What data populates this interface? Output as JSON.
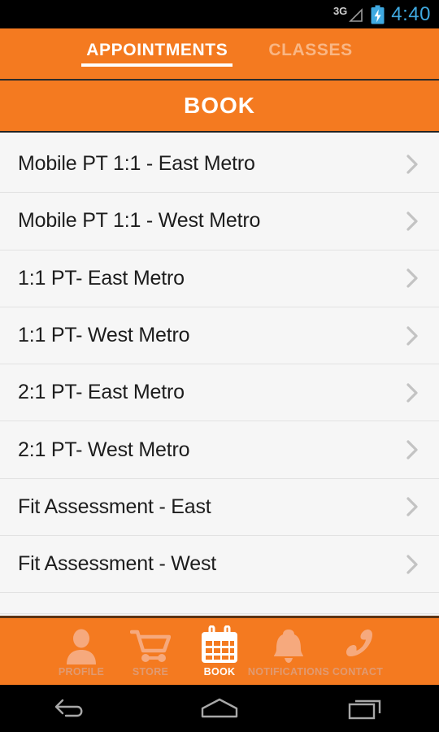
{
  "status_bar": {
    "network_label": "3G",
    "signal_icon": "signal-triangle-icon",
    "battery_icon": "battery-charging-icon",
    "time": "4:40",
    "time_color": "#3fa9e0"
  },
  "tabs": [
    {
      "label": "APPOINTMENTS",
      "active": true
    },
    {
      "label": "CLASSES",
      "active": false
    }
  ],
  "page_header": {
    "title": "BOOK"
  },
  "theme": {
    "accent": "#f47a20",
    "list_bg": "#f6f6f6",
    "divider": "#e2e2e2",
    "text": "#1d1d1d",
    "chevron": "#c3c3c3",
    "nav_inactive": "#f6a97d"
  },
  "list": {
    "chevron_icon": "chevron-right-icon",
    "items": [
      {
        "label": "Mobile PT 1:1 - East Metro"
      },
      {
        "label": "Mobile PT 1:1 - West Metro"
      },
      {
        "label": "1:1 PT- East Metro"
      },
      {
        "label": "1:1 PT- West Metro"
      },
      {
        "label": "2:1 PT- East Metro"
      },
      {
        "label": "2:1 PT- West Metro"
      },
      {
        "label": "Fit Assessment - East"
      },
      {
        "label": "Fit Assessment - West"
      }
    ]
  },
  "bottom_nav": [
    {
      "label": "PROFILE",
      "icon": "person-icon",
      "active": false
    },
    {
      "label": "STORE",
      "icon": "cart-icon",
      "active": false
    },
    {
      "label": "BOOK",
      "icon": "calendar-icon",
      "active": true
    },
    {
      "label": "NOTIFICATIONS",
      "icon": "bell-icon",
      "active": false
    },
    {
      "label": "CONTACT",
      "icon": "phone-icon",
      "active": false
    }
  ],
  "soft_nav": [
    {
      "icon": "back-icon"
    },
    {
      "icon": "home-icon"
    },
    {
      "icon": "recents-icon"
    }
  ]
}
